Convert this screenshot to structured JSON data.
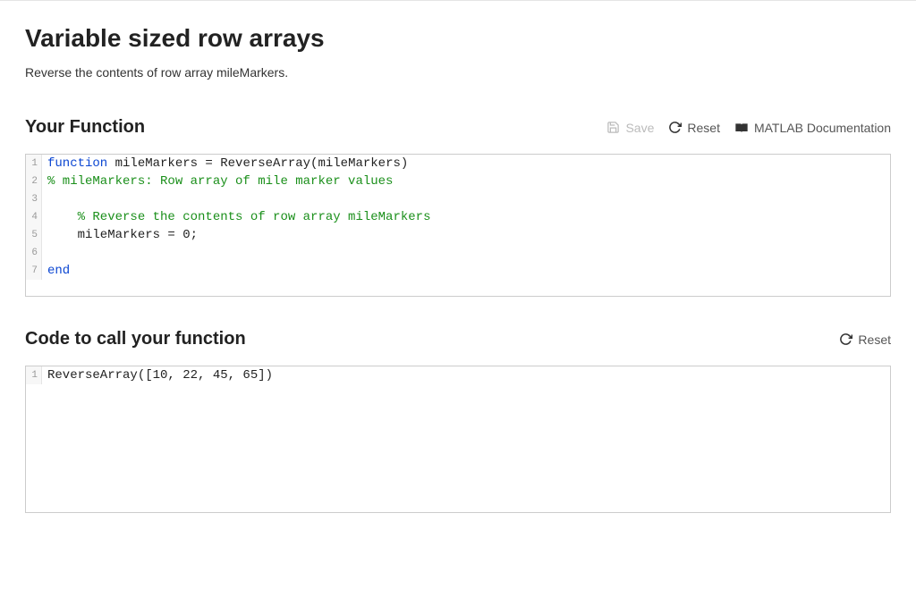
{
  "title": "Variable sized row arrays",
  "description": "Reverse the contents of row array mileMarkers.",
  "section1": {
    "heading": "Your Function",
    "toolbar": {
      "save": "Save",
      "reset": "Reset",
      "docs": "MATLAB Documentation"
    },
    "code": [
      {
        "n": "1",
        "tokens": [
          {
            "cls": "tok-keyword",
            "text": "function"
          },
          {
            "cls": "tok-default",
            "text": " mileMarkers = ReverseArray(mileMarkers)"
          }
        ]
      },
      {
        "n": "2",
        "tokens": [
          {
            "cls": "tok-comment",
            "text": "% mileMarkers: Row array of mile marker values"
          }
        ]
      },
      {
        "n": "3",
        "tokens": [
          {
            "cls": "tok-default",
            "text": ""
          }
        ]
      },
      {
        "n": "4",
        "tokens": [
          {
            "cls": "tok-comment",
            "text": "    % Reverse the contents of row array mileMarkers"
          }
        ]
      },
      {
        "n": "5",
        "tokens": [
          {
            "cls": "tok-default",
            "text": "    mileMarkers = 0;"
          }
        ]
      },
      {
        "n": "6",
        "tokens": [
          {
            "cls": "tok-default",
            "text": ""
          }
        ]
      },
      {
        "n": "7",
        "tokens": [
          {
            "cls": "tok-keyword",
            "text": "end"
          }
        ]
      }
    ]
  },
  "section2": {
    "heading": "Code to call your function",
    "toolbar": {
      "reset": "Reset"
    },
    "code": [
      {
        "n": "1",
        "tokens": [
          {
            "cls": "tok-default",
            "text": "ReverseArray([10, 22, 45, 65])"
          }
        ]
      }
    ]
  }
}
